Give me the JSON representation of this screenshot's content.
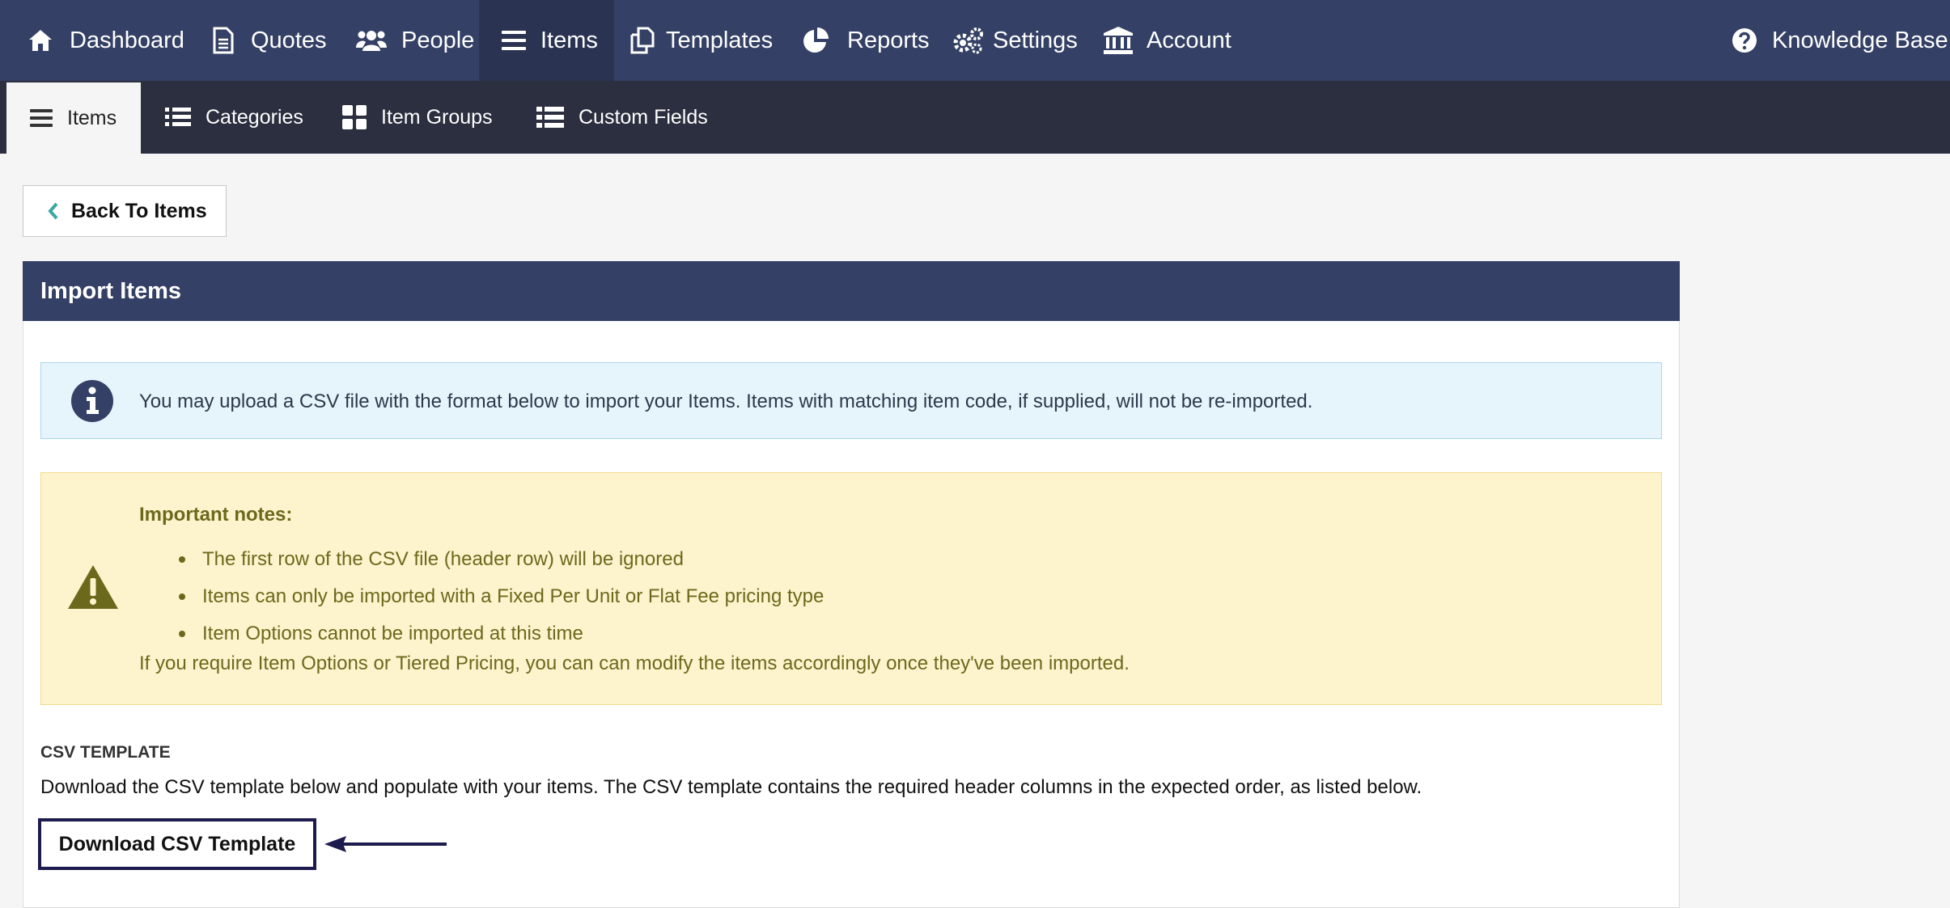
{
  "topnav": {
    "items": [
      {
        "label": "Dashboard",
        "icon": "home-icon"
      },
      {
        "label": "Quotes",
        "icon": "document-icon"
      },
      {
        "label": "People",
        "icon": "users-icon"
      },
      {
        "label": "Items",
        "icon": "list-icon",
        "active": true
      },
      {
        "label": "Templates",
        "icon": "copy-icon"
      },
      {
        "label": "Reports",
        "icon": "pie-chart-icon"
      },
      {
        "label": "Settings",
        "icon": "gears-icon"
      },
      {
        "label": "Account",
        "icon": "bank-icon"
      }
    ],
    "help": {
      "label": "Knowledge Base",
      "icon": "question-circle-icon"
    }
  },
  "subnav": {
    "items": [
      {
        "label": "Items",
        "icon": "list-icon",
        "active": true
      },
      {
        "label": "Categories",
        "icon": "list-ul-icon"
      },
      {
        "label": "Item Groups",
        "icon": "grid-icon"
      },
      {
        "label": "Custom Fields",
        "icon": "list-ul-icon"
      }
    ]
  },
  "back_button": {
    "label": "Back To Items",
    "icon": "chevron-left-icon"
  },
  "panel": {
    "title": "Import Items",
    "info": {
      "icon": "info-circle-icon",
      "text": "You may upload a CSV file with the format below to import your Items. Items with matching item code, if supplied, will not be re-imported."
    },
    "warning": {
      "icon": "warning-triangle-icon",
      "title": "Important notes:",
      "bullets": [
        "The first row of the CSV file (header row) will be ignored",
        "Items can only be imported with a Fixed Per Unit or Flat Fee pricing type",
        "Item Options cannot be imported at this time"
      ],
      "footer": "If you require Item Options or Tiered Pricing, you can can modify the items accordingly once they've been imported."
    },
    "csv": {
      "heading": "CSV TEMPLATE",
      "description": "Download the CSV template below and populate with your items. The CSV template contains the required header columns in the expected order, as listed below.",
      "button": "Download CSV Template"
    }
  },
  "colors": {
    "nav": "#344065",
    "nav_active": "#2a3352",
    "subnav": "#2b2f40",
    "info_bg": "#e6f4fc",
    "warn_bg": "#fdf3cd",
    "warn_text": "#6b6a1c",
    "accent_teal": "#3aa7a3"
  }
}
